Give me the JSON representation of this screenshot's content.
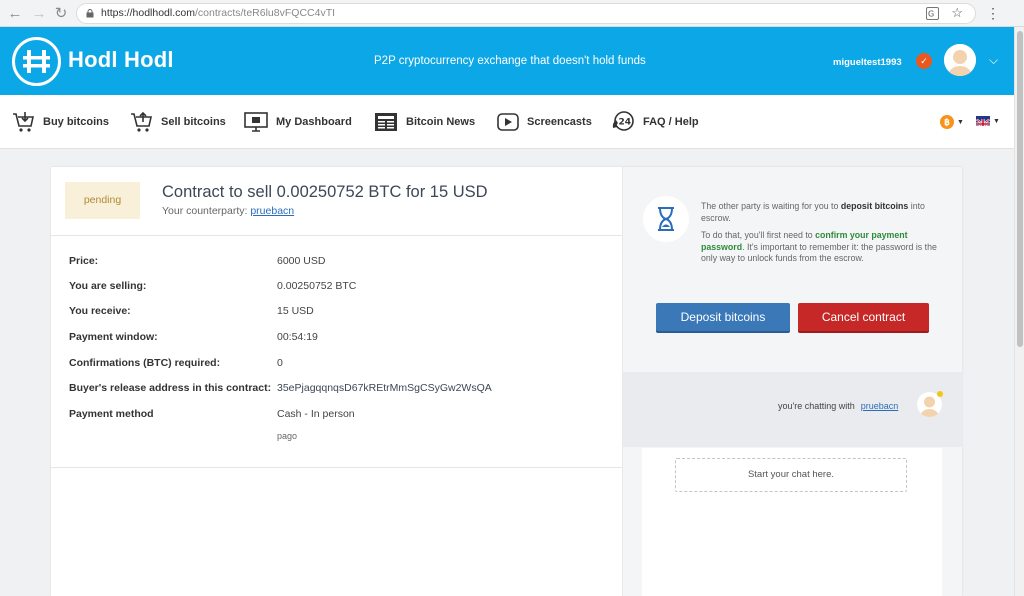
{
  "browser": {
    "url_host": "https://hodlhodl.com",
    "url_path": "/contracts/teR6lu8vFQCC4vTI"
  },
  "header": {
    "logo_text": "Hodl Hodl",
    "tagline": "P2P cryptocurrency exchange that doesn't hold funds",
    "username": "migueltest1993"
  },
  "nav": {
    "items": [
      {
        "label": "Buy bitcoins",
        "icon": "cart-down-icon"
      },
      {
        "label": "Sell bitcoins",
        "icon": "cart-up-icon"
      },
      {
        "label": "My Dashboard",
        "icon": "monitor-icon"
      },
      {
        "label": "Bitcoin News",
        "icon": "newspaper-icon"
      },
      {
        "label": "Screencasts",
        "icon": "play-icon"
      },
      {
        "label": "FAQ / Help",
        "icon": "support-24-icon"
      }
    ]
  },
  "contract": {
    "status": "pending",
    "title": "Contract to sell 0.00250752 BTC for 15 USD",
    "counterparty_label": "Your counterparty: ",
    "counterparty": "pruebacn",
    "rows": [
      {
        "label": "Price:",
        "value": "6000 USD"
      },
      {
        "label": "You are selling:",
        "value": "0.00250752 BTC"
      },
      {
        "label": "You receive:",
        "value": "15 USD"
      },
      {
        "label": "Payment window:",
        "value": "00:54:19"
      },
      {
        "label": "Confirmations (BTC) required:",
        "value": "0"
      },
      {
        "label": "Buyer's release address in this contract:",
        "value": "35ePjagqqnqsD67kREtrMmSgCSyGw2WsQA"
      },
      {
        "label": "Payment method",
        "value": "Cash - In person"
      }
    ],
    "payment_note": "pago"
  },
  "side": {
    "info_p1_a": "The other party is waiting for you to ",
    "info_p1_b": "deposit bitcoins",
    "info_p1_c": " into escrow.",
    "info_p2_a": "To do that, you'll first need to ",
    "info_p2_b": "confirm your payment password",
    "info_p2_c": ". It's important to remember it: the password is the only way to unlock funds from the escrow.",
    "deposit_label": "Deposit bitcoins",
    "cancel_label": "Cancel contract",
    "chatting_label": "you're chatting with",
    "chat_user": "pruebacn",
    "chat_placeholder": "Start your chat here."
  },
  "colors": {
    "brand_blue": "#0ca7e7",
    "deposit_button": "#3a78b8",
    "cancel_button": "#c62828",
    "pending_bg": "#f8f0d8"
  }
}
